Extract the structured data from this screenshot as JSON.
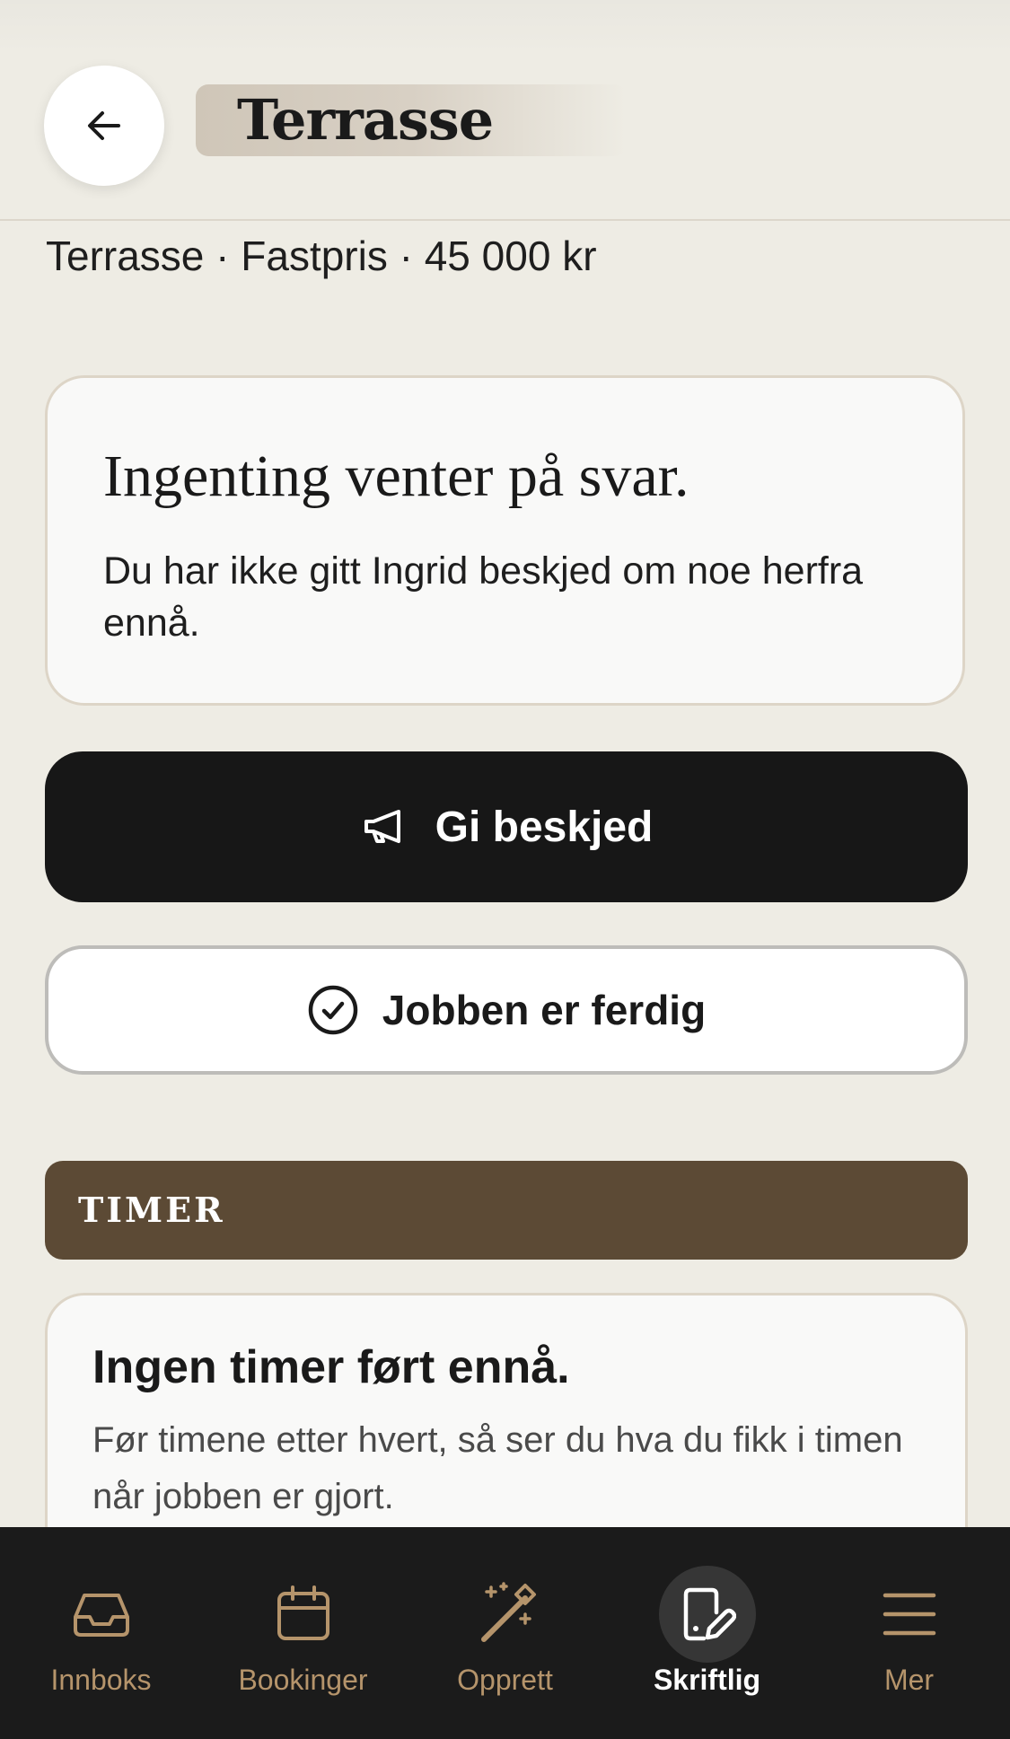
{
  "header": {
    "title": "Terrasse",
    "back_icon": "arrow-left-icon"
  },
  "job_summary": "Terrasse · Fastpris · 45 000 kr",
  "status_card": {
    "heading": "Ingenting venter på svar.",
    "body": "Du har ikke gitt Ingrid beskjed om noe herfra ennå."
  },
  "actions": {
    "notify": {
      "label": "Gi beskjed",
      "icon": "megaphone-icon"
    },
    "complete": {
      "label": "Jobben er ferdig",
      "icon": "check-circle-icon"
    }
  },
  "hours_section": {
    "title": "TIMER",
    "empty_heading": "Ingen timer ført ennå.",
    "empty_body": "Før timene etter hvert, så ser du hva du fikk i timen når jobben er gjort."
  },
  "nav": {
    "items": [
      {
        "label": "Innboks",
        "icon": "inbox-icon",
        "active": false
      },
      {
        "label": "Bookinger",
        "icon": "calendar-icon",
        "active": false
      },
      {
        "label": "Opprett",
        "icon": "magic-wand-icon",
        "active": false
      },
      {
        "label": "Skriftlig",
        "icon": "document-edit-icon",
        "active": true
      },
      {
        "label": "Mer",
        "icon": "menu-icon",
        "active": false
      }
    ]
  },
  "colors": {
    "background": "#EEECE4",
    "section_header": "#5C4A35",
    "primary_button": "#171717",
    "nav_background": "#1B1B1B",
    "nav_inactive": "#B5946B",
    "nav_active": "#FFFFFF"
  }
}
